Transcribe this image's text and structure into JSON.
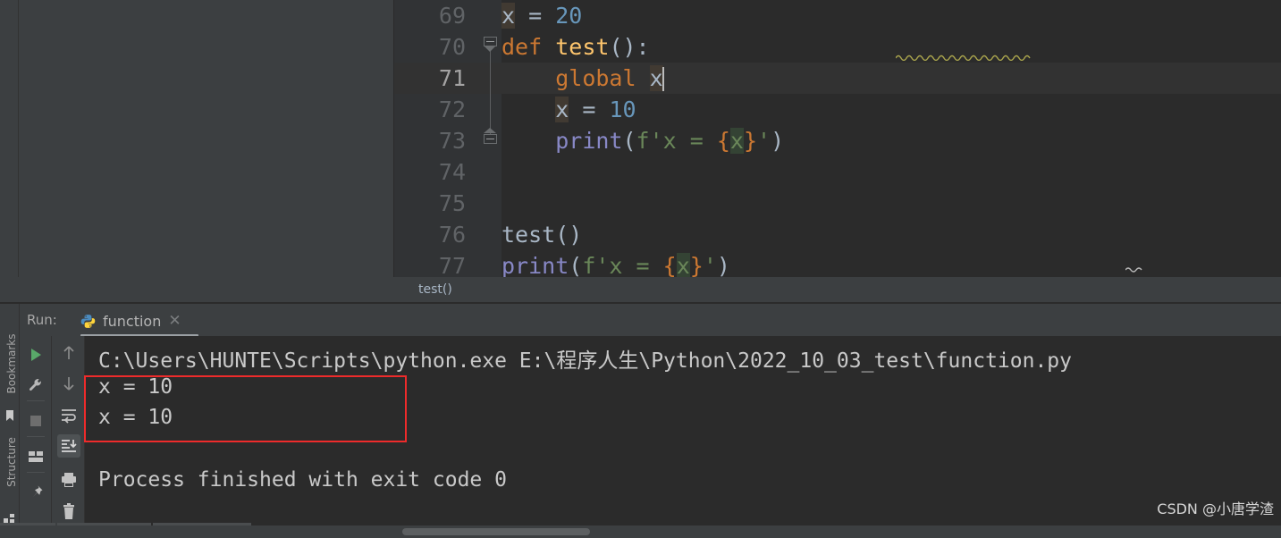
{
  "editor": {
    "lines": [
      {
        "num": "69",
        "active": false,
        "fold": null,
        "tokens": [
          {
            "t": "x",
            "c": "ident",
            "hl": "var"
          },
          {
            "t": " = ",
            "c": "pun"
          },
          {
            "t": "20",
            "c": "num"
          }
        ]
      },
      {
        "num": "70",
        "active": false,
        "fold": "collapse",
        "tokens": [
          {
            "t": "def ",
            "c": "kw"
          },
          {
            "t": "test",
            "c": "fn"
          },
          {
            "t": "():",
            "c": "pun"
          }
        ]
      },
      {
        "num": "71",
        "active": true,
        "fold": null,
        "tokens": [
          {
            "t": "    ",
            "c": "pun"
          },
          {
            "t": "global ",
            "c": "kw"
          },
          {
            "t": "x",
            "c": "ident",
            "hl": "var"
          },
          {
            "t": "",
            "c": "caret"
          }
        ]
      },
      {
        "num": "72",
        "active": false,
        "fold": null,
        "tokens": [
          {
            "t": "    ",
            "c": "pun"
          },
          {
            "t": "x",
            "c": "ident",
            "hl": "var"
          },
          {
            "t": " = ",
            "c": "pun"
          },
          {
            "t": "10",
            "c": "num"
          }
        ]
      },
      {
        "num": "73",
        "active": false,
        "fold": "endfold",
        "tokens": [
          {
            "t": "    ",
            "c": "pun"
          },
          {
            "t": "print",
            "c": "call"
          },
          {
            "t": "(",
            "c": "pun"
          },
          {
            "t": "f'x = ",
            "c": "str"
          },
          {
            "t": "{",
            "c": "brace"
          },
          {
            "t": "x",
            "c": "str",
            "hl": "str"
          },
          {
            "t": "}",
            "c": "brace"
          },
          {
            "t": "'",
            "c": "str"
          },
          {
            "t": ")",
            "c": "pun"
          }
        ]
      },
      {
        "num": "74",
        "active": false,
        "fold": null,
        "tokens": []
      },
      {
        "num": "75",
        "active": false,
        "fold": null,
        "tokens": []
      },
      {
        "num": "76",
        "active": false,
        "fold": null,
        "tokens": [
          {
            "t": "test",
            "c": "ident"
          },
          {
            "t": "()",
            "c": "pun"
          }
        ]
      },
      {
        "num": "77",
        "active": false,
        "fold": null,
        "tokens": [
          {
            "t": "print",
            "c": "call"
          },
          {
            "t": "(",
            "c": "pun"
          },
          {
            "t": "f'x = ",
            "c": "str"
          },
          {
            "t": "{",
            "c": "brace"
          },
          {
            "t": "x",
            "c": "str",
            "hl": "str"
          },
          {
            "t": "}",
            "c": "brace"
          },
          {
            "t": "'",
            "c": "str"
          },
          {
            "t": ")",
            "c": "pun"
          }
        ]
      }
    ],
    "breadcrumb": "test()"
  },
  "left_rail": {
    "bookmarks_label": "Bookmarks",
    "structure_label": "Structure"
  },
  "run_panel": {
    "run_label": "Run:",
    "tab_name": "function",
    "tab_close": "✕",
    "toolbar_primary": [
      {
        "name": "run-button",
        "title": "Run"
      },
      {
        "name": "settings-wrench-icon",
        "title": "Settings"
      },
      {
        "name": "stop-button",
        "title": "Stop"
      },
      {
        "name": "layout-button",
        "title": "Layout"
      },
      {
        "name": "pin-button",
        "title": "Pin Tab"
      }
    ],
    "toolbar_console": [
      {
        "name": "up-arrow-icon",
        "title": "Up the stack trace"
      },
      {
        "name": "down-arrow-icon",
        "title": "Down the stack trace"
      },
      {
        "name": "soft-wrap-icon",
        "title": "Soft-Wrap"
      },
      {
        "name": "scroll-to-end-icon",
        "title": "Scroll to end",
        "active": true
      },
      {
        "name": "print-icon",
        "title": "Print"
      },
      {
        "name": "trash-icon",
        "title": "Clear All"
      }
    ]
  },
  "console": {
    "command_line": "C:\\Users\\HUNTE\\Scripts\\python.exe E:\\程序人生\\Python\\2022_10_03_test\\function.py",
    "output_lines": [
      "x = 10",
      "x = 10"
    ],
    "exit_line": "Process finished with exit code 0",
    "highlight_color": "#ee2b2b"
  },
  "watermark": "CSDN @小唐学渣",
  "colors": {
    "editor_bg": "#2b2b2b",
    "panel_bg": "#3c3f41",
    "gutter_bg": "#313335",
    "active_line": "#323232",
    "text": "#a9b7c6",
    "keyword": "#cc7832",
    "function": "#ffc66d",
    "number": "#6897bb",
    "string": "#6a8759",
    "call": "#8888c6",
    "line_number": "#606366"
  }
}
